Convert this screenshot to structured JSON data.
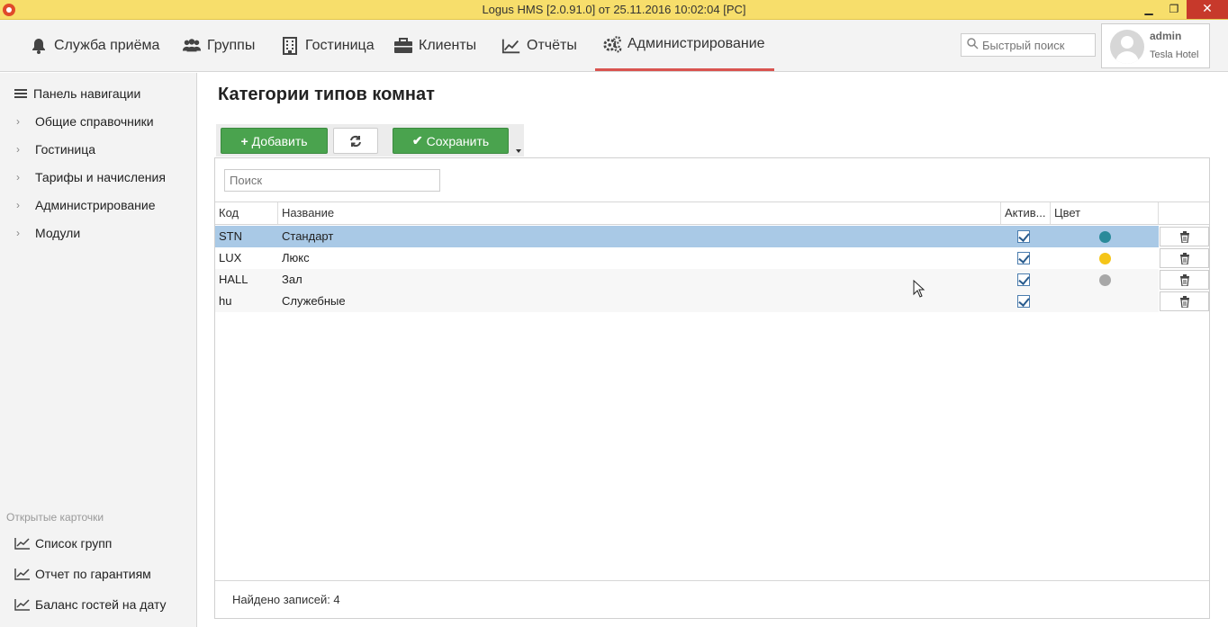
{
  "window": {
    "title": "Logus HMS [2.0.91.0] от 25.11.2016 10:02:04 [PC]",
    "min_glyph": "▁",
    "max_glyph": "❐",
    "close_glyph": "✕"
  },
  "nav": {
    "items": [
      {
        "label": "Служба приёма",
        "icon": "bell-icon"
      },
      {
        "label": "Группы",
        "icon": "users-icon"
      },
      {
        "label": "Гостиница",
        "icon": "building-icon"
      },
      {
        "label": "Клиенты",
        "icon": "briefcase-icon"
      },
      {
        "label": "Отчёты",
        "icon": "chart-icon"
      },
      {
        "label": "Администрирование",
        "icon": "gears-icon",
        "active": true
      }
    ],
    "search_placeholder": "Быстрый поиск",
    "user": {
      "name": "admin",
      "hotel": "Tesla Hotel"
    }
  },
  "sidebar": {
    "items": [
      {
        "label": "Панель навигации",
        "icon": "menu-icon"
      },
      {
        "label": "Общие справочники",
        "icon": "chevron-right-icon"
      },
      {
        "label": "Гостиница",
        "icon": "chevron-right-icon"
      },
      {
        "label": "Тарифы и начисления",
        "icon": "chevron-right-icon"
      },
      {
        "label": "Администрирование",
        "icon": "chevron-right-icon"
      },
      {
        "label": "Модули",
        "icon": "chevron-right-icon"
      }
    ],
    "open_cards_label": "Открытые карточки",
    "open_cards": [
      {
        "label": "Список групп"
      },
      {
        "label": "Отчет по гарантиям"
      },
      {
        "label": "Баланс гостей на дату"
      }
    ]
  },
  "main": {
    "title": "Категории типов комнат",
    "toolbar": {
      "add_label": "Добавить",
      "save_label": "Сохранить"
    },
    "grid": {
      "search_placeholder": "Поиск",
      "columns": {
        "code": "Код",
        "name": "Название",
        "active": "Актив...",
        "color": "Цвет"
      },
      "rows": [
        {
          "code": "STN",
          "name": "Стандарт",
          "active": true,
          "color": "#2a8a9a",
          "selected": true
        },
        {
          "code": "LUX",
          "name": "Люкс",
          "active": true,
          "color": "#f5c518"
        },
        {
          "code": "HALL",
          "name": "Зал",
          "active": true,
          "color": "#a8a8a8"
        },
        {
          "code": "hu",
          "name": "Служебные",
          "active": true,
          "color": ""
        }
      ],
      "footer": "Найдено записей: 4"
    }
  },
  "colors": {
    "titlebar": "#f7de6b",
    "accent_green": "#4aa34e",
    "active_tab_underline": "#d9534f",
    "selected_row": "#a9c9e6"
  }
}
